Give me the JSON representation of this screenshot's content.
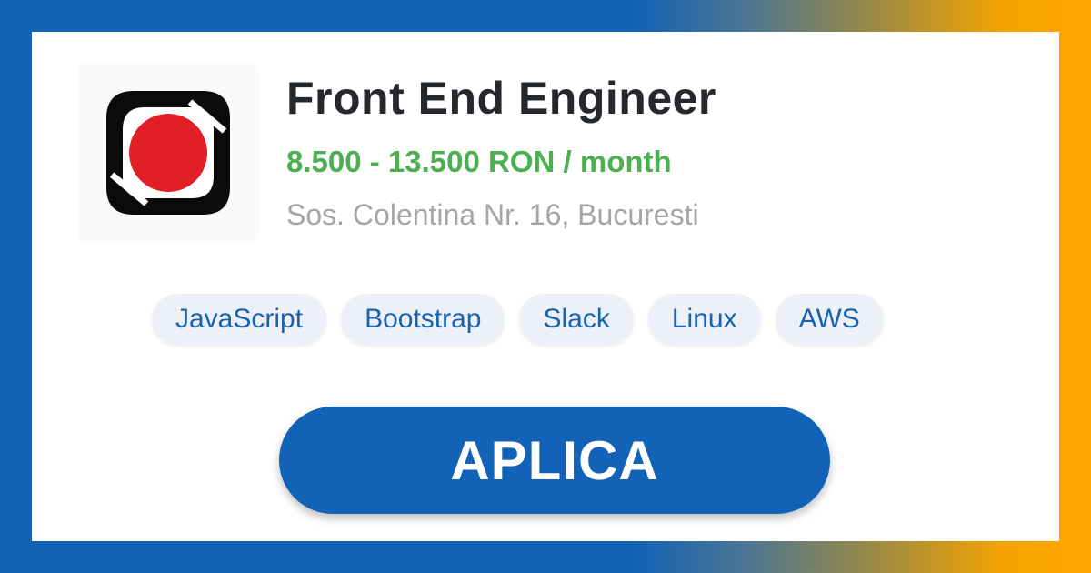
{
  "job": {
    "title": "Front End Engineer",
    "salary": "8.500 - 13.500 RON / month",
    "location": "Sos. Colentina Nr. 16, Bucuresti"
  },
  "logo": {
    "icon": "company-logo-icon",
    "ring_color": "#0b0b0b",
    "dot_color": "#e01f26"
  },
  "tags": [
    "JavaScript",
    "Bootstrap",
    "Slack",
    "Linux",
    "AWS"
  ],
  "apply_button": {
    "label": "APLICA"
  },
  "colors": {
    "brand_blue": "#1262b8",
    "accent_orange": "#ffa500",
    "salary_green": "#4caf50",
    "tag_background": "#edf0f7"
  }
}
